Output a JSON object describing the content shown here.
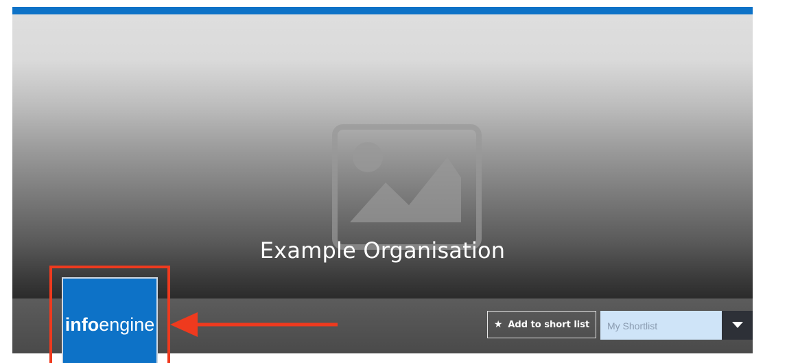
{
  "org": {
    "title": "Example Organisation"
  },
  "logo": {
    "bold_part": "info",
    "regular_part": "engine"
  },
  "actions": {
    "shortlist_button": "Add to short list",
    "shortlist_select": "My Shortlist"
  },
  "icons": {
    "hero": "image-placeholder-icon",
    "star": "star-icon",
    "dropdown": "chevron-down-icon"
  },
  "colors": {
    "brand_blue": "#0d72c7",
    "annotation_red": "#ef3a1e",
    "select_bg": "#cfe4f8"
  }
}
